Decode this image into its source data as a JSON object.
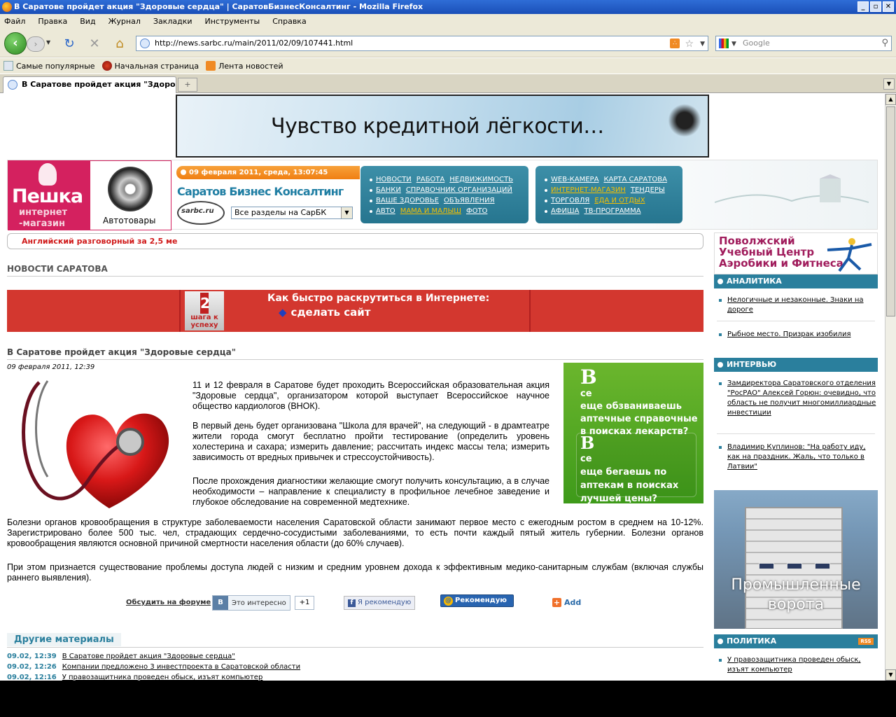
{
  "window": {
    "title": "В Саратове пройдет акция \"Здоровые сердца\" | СаратовБизнесКонсалтинг - Mozilla Firefox",
    "controls": [
      "_",
      "▫",
      "✕"
    ]
  },
  "menu": [
    "Файл",
    "Правка",
    "Вид",
    "Журнал",
    "Закладки",
    "Инструменты",
    "Справка"
  ],
  "toolbar": {
    "url": "http://news.sarbc.ru/main/2011/02/09/107441.html",
    "search_placeholder": "Google"
  },
  "bookmarks": [
    {
      "label": "Самые популярные",
      "icon": "page-icon"
    },
    {
      "label": "Начальная страница",
      "icon": "firefox-icon"
    },
    {
      "label": "Лента новостей",
      "icon": "rss-icon"
    }
  ],
  "tab": {
    "label": "В Саратове пройдет акция \"Здоро…",
    "new_tab": "+"
  },
  "banner": {
    "text": "Чувство кредитной лёгкости…"
  },
  "header": {
    "peshka_name": "Пешка",
    "peshka_sub1": "интернет",
    "peshka_sub2": "-магазин",
    "auto_label": "Автотовары",
    "date": "09 февраля 2011, среда, 13:07:45",
    "logo": "Саратов Бизнес Консалтинг",
    "logo_small": "sarbc.ru",
    "select_value": "Все разделы на СарБК",
    "nav1": [
      [
        {
          "t": "НОВОСТИ"
        },
        {
          "t": "РАБОТА"
        },
        {
          "t": "НЕДВИЖИМОСТЬ"
        }
      ],
      [
        {
          "t": "БАНКИ"
        },
        {
          "t": "СПРАВОЧНИК ОРГАНИЗАЦИЙ"
        }
      ],
      [
        {
          "t": "ВАШЕ ЗДОРОВЬЕ"
        },
        {
          "t": "ОБЪЯВЛЕНИЯ"
        }
      ],
      [
        {
          "t": "АВТО"
        },
        {
          "t": "МАМА И МАЛЫШ",
          "hl": true
        },
        {
          "t": "ФОТО"
        }
      ]
    ],
    "nav2": [
      [
        {
          "t": "WEB-КАМЕРА"
        },
        {
          "t": "КАРТА САРАТОВА"
        }
      ],
      [
        {
          "t": "ИНТЕРНЕТ-МАГАЗИН",
          "hl": true
        },
        {
          "t": "ТЕНДЕРЫ"
        }
      ],
      [
        {
          "t": "ТОРГОВЛЯ"
        },
        {
          "t": "ЕДА И ОТДЫХ",
          "hl": true
        }
      ],
      [
        {
          "t": "АФИША"
        },
        {
          "t": "ТВ-ПРОГРАММА"
        }
      ]
    ]
  },
  "promo": "Английский разговорный за 2,5 ме",
  "section_title": "НОВОСТИ САРАТОВА",
  "ad_red": {
    "step_num": "2",
    "step_text": "шага к успеху",
    "line1": "Как быстро раскрутиться в Интернете:",
    "line2": "сделать сайт"
  },
  "article": {
    "title": "В Саратове пройдет акция \"Здоровые сердца\"",
    "date": "09 февраля 2011, 12:39",
    "p1": "11 и 12 февраля в Саратове будет проходить Всероссийская образовательная акция \"Здоровые сердца\", организатором которой выступает Всероссийское научное общество кардиологов (ВНОК).",
    "p2": "В первый день будет организована \"Школа для врачей\", на следующий - в драмтеатре жители города смогут бесплатно пройти тестирование (определить уровень холестерина и сахара; измерить давление; рассчитать индекс массы тела; измерить зависимость от вредных привычек и стрессоустойчивость).",
    "p3": "После прохождения диагностики желающие смогут получить консультацию, а в случае необходимости – направление к специалисту в профильное лечебное заведение и глубокое обследование на современной медтехнике.",
    "p4": "Болезни органов кровообращения в структуре заболеваемости населения Саратовской области занимают первое место с ежегодным ростом в среднем на 10-12%. Зарегистрировано более 500 тыс. чел, страдающих сердечно-сосудистыми заболеваниями, то есть почти каждый пятый житель губернии. Болезни органов кровообращения являются основной причиной смертности населения области (до 60% случаев).",
    "p5": "При этом признается существование проблемы доступа людей с низким и средним уровнем дохода к эффективным медико-санитарным службам (включая службы раннего выявления)."
  },
  "green_ad": {
    "b1": "В",
    "l1": "се\nеще обзваниваешь аптечные справочные в поисках лекарств?",
    "b2": "В",
    "l2": "се\nеще бегаешь по аптекам в поисках лучшей цены?"
  },
  "share": {
    "forum": "Обсудить на форуме",
    "vk_label": "Это интересно",
    "vk_count": "+1",
    "fb": "Я рекомендую",
    "mail": "Рекомендую",
    "add": "Add"
  },
  "other": {
    "title": "Другие материалы",
    "items": [
      {
        "d": "09.02, 12:39",
        "t": "В Саратове пройдет акция \"Здоровые сердца\""
      },
      {
        "d": "09.02, 12:26",
        "t": "Компании предложено 3 инвестпроекта в Саратовской области"
      },
      {
        "d": "09.02, 12:16",
        "t": "У правозащитника проведен обыск, изъят компьютер"
      }
    ]
  },
  "sidebar": {
    "fit_ad": "Поволжский\nУчебный Центр\nАэробики и Фитнеса",
    "analytics": {
      "title": "АНАЛИТИКА",
      "items": [
        "Нелогичные и незаконные. Знаки на дороге",
        "Рыбное место. Призрак изобилия"
      ]
    },
    "interview": {
      "title": "ИНТЕРВЬЮ",
      "items": [
        "Замдиректора Саратовского отделения \"РосРАО\" Алексей Горюн: очевидно, что область не получит многомиллиардные инвестиции",
        "Владимир Куплинов: \"На работу иду, как на праздник. Жаль, что только в Латвии\""
      ]
    },
    "gate_ad": "Промышленные\nворота",
    "politics": {
      "title": "ПОЛИТИКА",
      "rss": "RSS",
      "items": [
        "У правозащитника проведен обыск, изъят компьютер"
      ]
    }
  }
}
